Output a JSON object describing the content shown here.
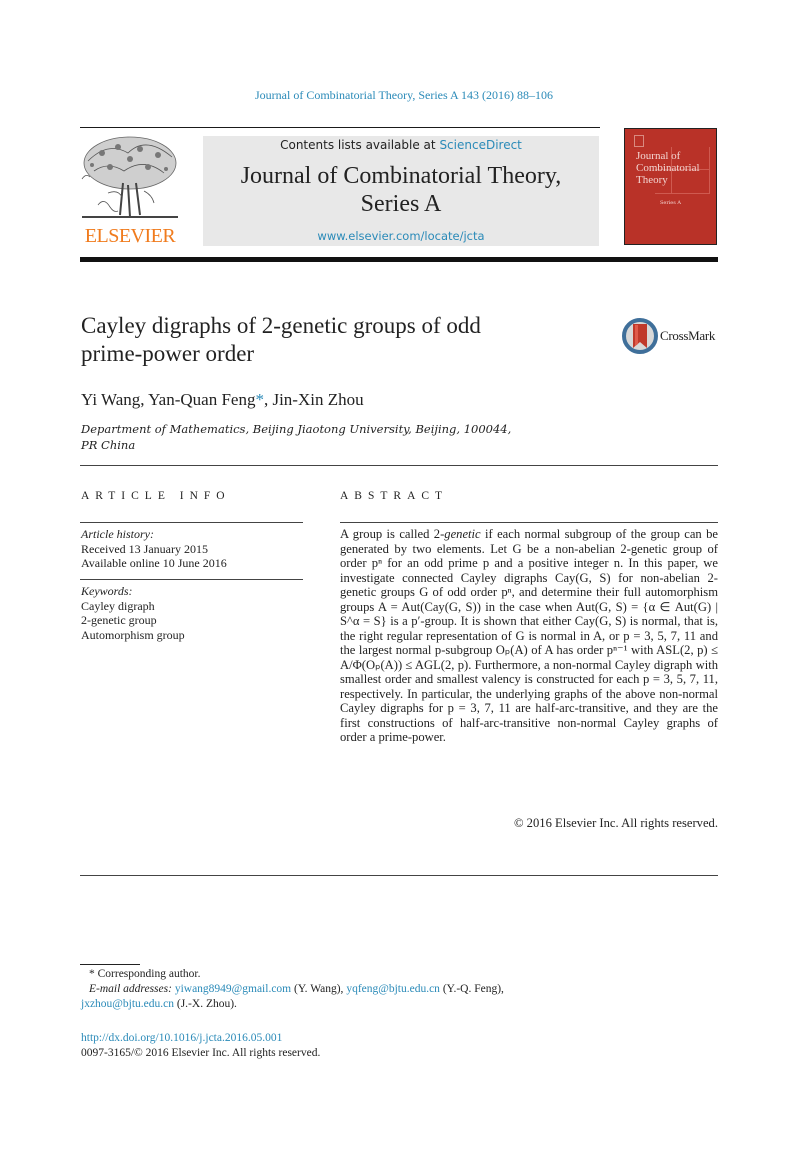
{
  "journal_reference": "Journal of Combinatorial Theory, Series A 143 (2016) 88–106",
  "header": {
    "publisher_logo_text": "ELSEVIER",
    "contents_prefix": "Contents lists available at ",
    "contents_link": "ScienceDirect",
    "journal_title_line1": "Journal of Combinatorial Theory,",
    "journal_title_line2": "Series A",
    "journal_url": "www.elsevier.com/locate/jcta",
    "cover": {
      "title_line1": "Journal of",
      "title_line2": "Combinatorial",
      "title_line3": "Theory",
      "subtitle": "Series A",
      "color": "#b93228"
    }
  },
  "article": {
    "title_line1": "Cayley digraphs of 2-genetic groups of odd",
    "title_line2": "prime-power order",
    "crossmark_label": "CrossMark",
    "authors": {
      "author1": "Yi Wang, ",
      "author2": "Yan-Quan Feng",
      "corresponding_mark": "*",
      "author3": ", Jin-Xin Zhou"
    },
    "affiliation_line1": "Department of Mathematics, Beijing Jiaotong University, Beijing, 100044,",
    "affiliation_line2": "PR China"
  },
  "article_info": {
    "heading": "ARTICLE INFO",
    "history_label": "Article history:",
    "received": "Received 13 January 2015",
    "available": "Available online 10 June 2016",
    "keywords_label": "Keywords:",
    "keywords": [
      "Cayley digraph",
      "2-genetic group",
      "Automorphism group"
    ]
  },
  "abstract": {
    "heading": "ABSTRACT",
    "p1_a": "A group is called 2-",
    "p1_em": "genetic",
    "p1_b": " if each normal subgroup of the group can be generated by two elements. Let G be a non-abelian 2-genetic group of order pⁿ for an odd prime p and a positive integer n. In this paper, we investigate connected Cayley digraphs Cay(G, S) for non-abelian 2-genetic groups G of odd order pⁿ, and determine their full automorphism groups A = Aut(Cay(G, S)) in the case when Aut(G, S) = {α ∈ Aut(G) | S^α = S} is a p′-group. It is shown that either Cay(G, S) is normal, that is, the right regular representation of G is normal in A, or p = 3, 5, 7, 11 and the largest normal p-subgroup Oₚ(A) of A has order pⁿ⁻¹ with ASL(2, p) ≤ A/Φ(Oₚ(A)) ≤ AGL(2, p). Furthermore, a non-normal Cayley digraph with smallest order and smallest valency is constructed for each p = 3, 5, 7, 11, respectively. In particular, the underlying graphs of the above non-normal Cayley digraphs for p = 3, 7, 11 are half-arc-transitive, and they are the first constructions of half-arc-transitive non-normal Cayley graphs of order a prime-power.",
    "copyright": "© 2016 Elsevier Inc. All rights reserved."
  },
  "footnotes": {
    "star": "*",
    "corresponding": " Corresponding author.",
    "email_label": "E-mail addresses:",
    "email1": "yiwang8949@gmail.com",
    "email1_owner": " (Y. Wang), ",
    "email2": "yqfeng@bjtu.edu.cn",
    "email2_owner": " (Y.-Q. Feng),",
    "email3": "jxzhou@bjtu.edu.cn",
    "email3_owner": " (J.-X. Zhou)."
  },
  "doi": {
    "url": "http://dx.doi.org/10.1016/j.jcta.2016.05.001",
    "issn_copyright": "0097-3165/© 2016 Elsevier Inc. All rights reserved."
  },
  "colors": {
    "link": "#2a8ab8",
    "elsevier_orange": "#f07b1d",
    "banner_bg": "#e8e8e8"
  }
}
